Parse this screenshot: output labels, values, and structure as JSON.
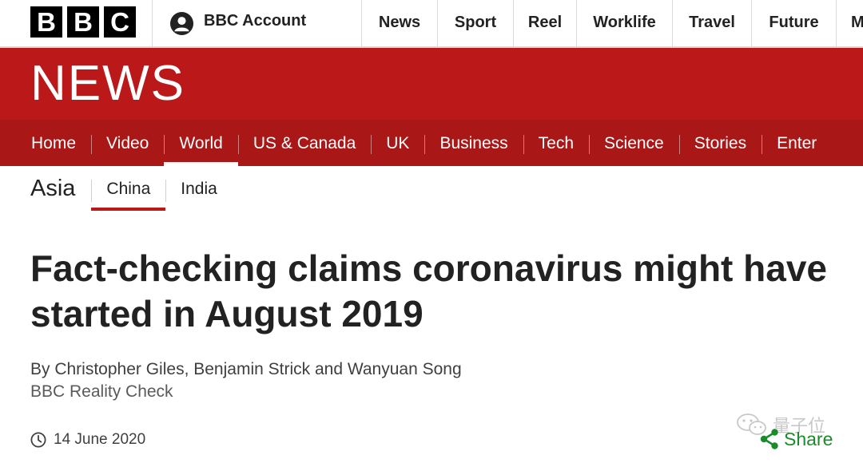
{
  "colors": {
    "brand_red": "#bb1919",
    "nav_red": "#a91717",
    "text": "#222222",
    "share_green": "#1a8b2a"
  },
  "topbar": {
    "logo_letters": [
      "B",
      "B",
      "C"
    ],
    "account_label": "BBC Account",
    "account_icon": "user-icon",
    "nav": [
      {
        "label": "News"
      },
      {
        "label": "Sport"
      },
      {
        "label": "Reel"
      },
      {
        "label": "Worklife"
      },
      {
        "label": "Travel"
      },
      {
        "label": "Future"
      },
      {
        "label": "M"
      }
    ]
  },
  "news_band": {
    "wordmark": "NEWS"
  },
  "section_nav": {
    "items": [
      {
        "label": "Home"
      },
      {
        "label": "Video"
      },
      {
        "label": "World",
        "active": true
      },
      {
        "label": "US & Canada"
      },
      {
        "label": "UK"
      },
      {
        "label": "Business"
      },
      {
        "label": "Tech"
      },
      {
        "label": "Science"
      },
      {
        "label": "Stories"
      },
      {
        "label": "Enter"
      }
    ]
  },
  "subnav": {
    "title": "Asia",
    "items": [
      {
        "label": "China",
        "active": true
      },
      {
        "label": "India"
      }
    ]
  },
  "article": {
    "headline": "Fact-checking claims coronavirus might have started in August 2019",
    "byline": "By Christopher Giles, Benjamin Strick and Wanyuan Song",
    "org": "BBC Reality Check",
    "date": "14 June 2020",
    "date_icon": "clock-icon"
  },
  "watermark": {
    "text": "量子位",
    "icon": "wechat-icon"
  },
  "share": {
    "label": "Share",
    "icon": "share-icon"
  }
}
